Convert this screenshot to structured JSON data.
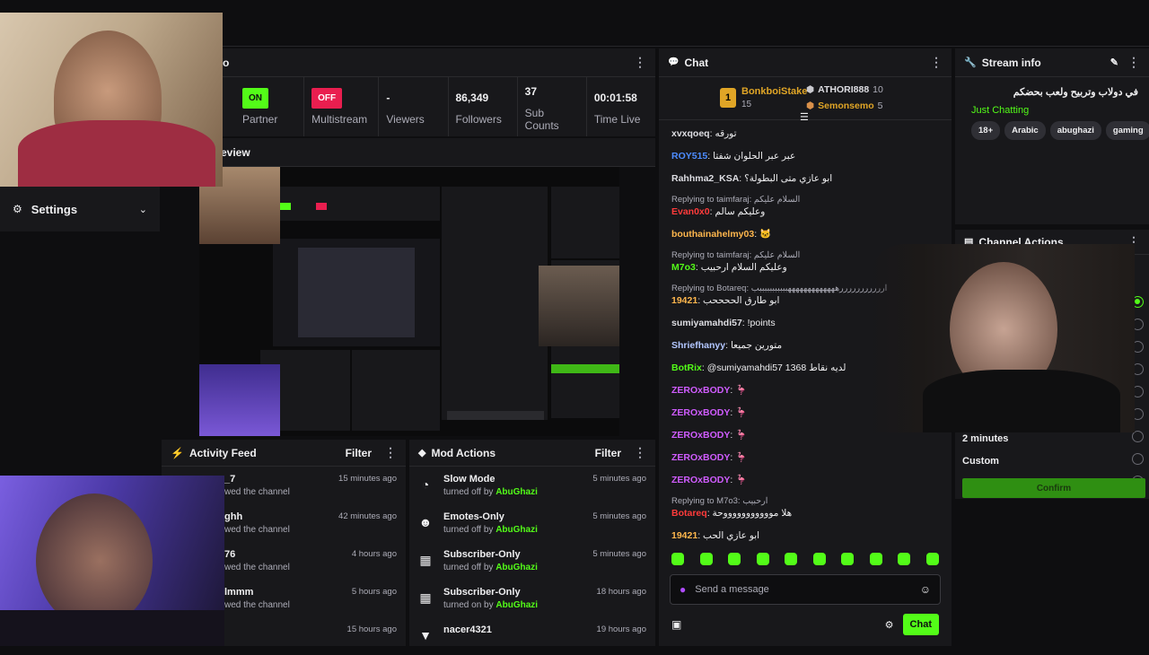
{
  "topbar": {},
  "stats": {
    "header_partial": "fo",
    "partner": {
      "badge": "ON",
      "label": "Partner Income"
    },
    "multistream": {
      "badge": "OFF",
      "label": "Multistream"
    },
    "viewers": {
      "value": "-",
      "label": "Viewers"
    },
    "followers": {
      "value": "86,349",
      "label": "Followers"
    },
    "subs": {
      "value": "37",
      "label": "Sub Counts"
    },
    "time": {
      "value": "00:01:58",
      "label": "Time Live"
    }
  },
  "preview": {
    "title_partial": "eview"
  },
  "settings": {
    "label": "Settings"
  },
  "activity": {
    "title": "Activity Feed",
    "filter": "Filter",
    "items": [
      {
        "name": "_7",
        "sub": "wed the channel",
        "time": "15 minutes ago"
      },
      {
        "name": "ghh",
        "sub": "wed the channel",
        "time": "42 minutes ago"
      },
      {
        "name": "76",
        "sub": "wed the channel",
        "time": "4 hours ago"
      },
      {
        "name": "lmmm",
        "sub": "wed the channel",
        "time": "5 hours ago"
      },
      {
        "name": "",
        "sub": "",
        "time": "15 hours ago"
      }
    ]
  },
  "mod": {
    "title": "Mod Actions",
    "filter": "Filter",
    "items": [
      {
        "icon": "slow-mode-icon",
        "glyph": "◔",
        "name": "Slow Mode",
        "action": "turned off by",
        "by": "AbuGhazi",
        "time": "5 minutes ago"
      },
      {
        "icon": "emote-icon",
        "glyph": "☻",
        "name": "Emotes-Only",
        "action": "turned off by",
        "by": "AbuGhazi",
        "time": "5 minutes ago"
      },
      {
        "icon": "gift-icon",
        "glyph": "▦",
        "name": "Subscriber-Only",
        "action": "turned off by",
        "by": "AbuGhazi",
        "time": "5 minutes ago"
      },
      {
        "icon": "gift-icon",
        "glyph": "▦",
        "name": "Subscriber-Only",
        "action": "turned on by",
        "by": "AbuGhazi",
        "time": "18 hours ago"
      },
      {
        "icon": "chevron-down-icon",
        "glyph": "▼",
        "name": "nacer4321",
        "action": "",
        "by": "",
        "time": "19 hours ago"
      }
    ]
  },
  "chat": {
    "title": "Chat",
    "leaders": [
      {
        "rank": "1",
        "name": "BonkboiStake",
        "count": "15"
      },
      {
        "rank": "2",
        "name": "ATHORI888",
        "count": "10"
      },
      {
        "rank": "3",
        "name": "Semonsemo",
        "count": "5"
      }
    ],
    "messages": [
      {
        "user": "xvxqoeq",
        "color": "#dedee3",
        "text": "تورقه"
      },
      {
        "user": "ROY515",
        "color": "#4d8cff",
        "text": "عبر عبر الحلوان شفتا"
      },
      {
        "user": "Rahhma2_KSA",
        "color": "#dedee3",
        "text": "ابو عازي متى البطولة؟"
      },
      {
        "reply": "Replying to taimfaraj: السلام عليكم",
        "user": "Evan0x0",
        "color": "#ff3b3b",
        "text": "وعليكم سالم"
      },
      {
        "user": "bouthainahelmy03",
        "color": "#ffb74d",
        "text": "🐱"
      },
      {
        "reply": "Replying to taimfaraj: السلام عليكم",
        "user": "M7o3",
        "color": "#53fc18",
        "text": "وعليكم السلام ارحبيب"
      },
      {
        "reply": "Replying to Botareq: ارررررررررررهههههههههههههبببببببببببب",
        "user": "19421",
        "color": "#ffb74d",
        "text": "ابو طارق الححححب"
      },
      {
        "user": "sumiyamahdi57",
        "color": "#dedee3",
        "text": "!points"
      },
      {
        "user": "Shriefhanyy",
        "color": "#b3c7ff",
        "text": "متورين جميعا"
      },
      {
        "user": "BotRix",
        "color": "#53fc18",
        "text": "@sumiyamahdi57 1368 لديه نقاط"
      },
      {
        "user": "ZEROxBODY",
        "color": "#d05cff",
        "text": "🦩"
      },
      {
        "user": "ZEROxBODY",
        "color": "#d05cff",
        "text": "🦩"
      },
      {
        "user": "ZEROxBODY",
        "color": "#d05cff",
        "text": "🦩"
      },
      {
        "user": "ZEROxBODY",
        "color": "#d05cff",
        "text": "🦩"
      },
      {
        "user": "ZEROxBODY",
        "color": "#d05cff",
        "text": "🦩"
      },
      {
        "reply": "Replying to M7o3: ارحبيب",
        "user": "Botareq",
        "color": "#ff3b3b",
        "text": "هلا موووووووووووحة"
      },
      {
        "user": "19421",
        "color": "#ffb74d",
        "text": "ابو عازي الحب"
      }
    ],
    "input_placeholder": "Send a message",
    "send": "Chat"
  },
  "streaminfo": {
    "title": "Stream info",
    "stream_title": "في دولاب وتربيح ولعب بحضكم",
    "category": "Just Chatting",
    "tags": [
      "18+",
      "Arabic",
      "abughazi",
      "gaming"
    ]
  },
  "channel": {
    "title": "Channel Actions",
    "options": [
      "2 minutes",
      "Custom"
    ],
    "confirm": "Confirm"
  }
}
